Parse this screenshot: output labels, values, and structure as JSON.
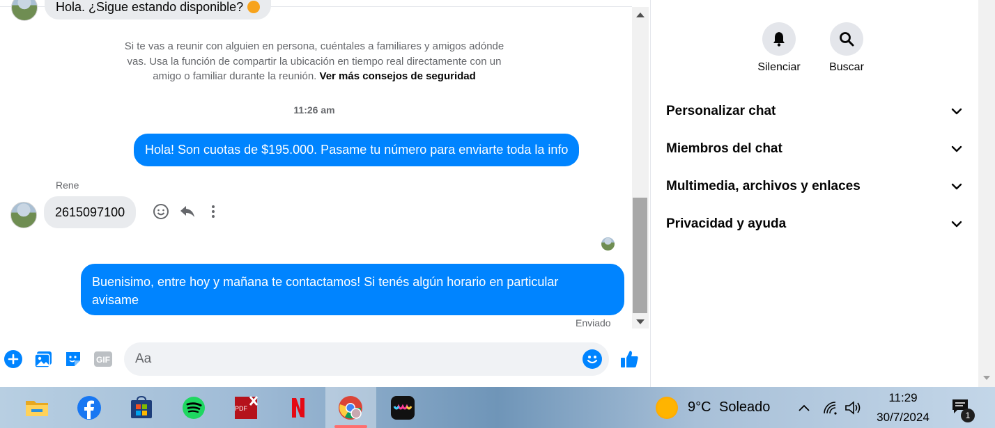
{
  "chat": {
    "top_message": "Hola. ¿Sigue estando disponible?",
    "safety_notice": "Si te vas a reunir con alguien en persona, cuéntales a familiares y amigos adóndevas. Usa la función de compartir la ubicación en tiempo real directamente con un amigo o familiar durante la reunión.",
    "safety_notice_line1": "Si te vas a reunir con alguien en persona, cuéntales a familiares y amigos adónde",
    "safety_notice_line2": "vas. Usa la función de compartir la ubicación en tiempo real directamente con un",
    "safety_notice_line3": "amigo o familiar durante la reunión.",
    "safety_link": "Ver más consejos de seguridad",
    "timestamp": "11:26 am",
    "outgoing_1": "Hola! Son cuotas de $195.000. Pasame tu número para enviarte toda la info",
    "sender_name": "Rene",
    "incoming_1": "2615097100",
    "outgoing_2_line1": "Buenisimo, entre hoy y mañana te contactamos! Si tenés algún horario en particular",
    "outgoing_2_line2": "avisame",
    "status": "Enviado"
  },
  "composer": {
    "placeholder": "Aa"
  },
  "panel": {
    "mute_label": "Silenciar",
    "search_label": "Buscar",
    "sections": [
      {
        "label": "Personalizar chat"
      },
      {
        "label": "Miembros del chat"
      },
      {
        "label": "Multimedia, archivos y enlaces"
      },
      {
        "label": "Privacidad y ayuda"
      }
    ]
  },
  "taskbar": {
    "weather_temp": "9°C",
    "weather_desc": "Soleado",
    "time": "11:29",
    "date": "30/7/2024",
    "notification_count": "1"
  },
  "colors": {
    "accent": "#0084ff",
    "incoming_bubble": "#e9ebee"
  }
}
